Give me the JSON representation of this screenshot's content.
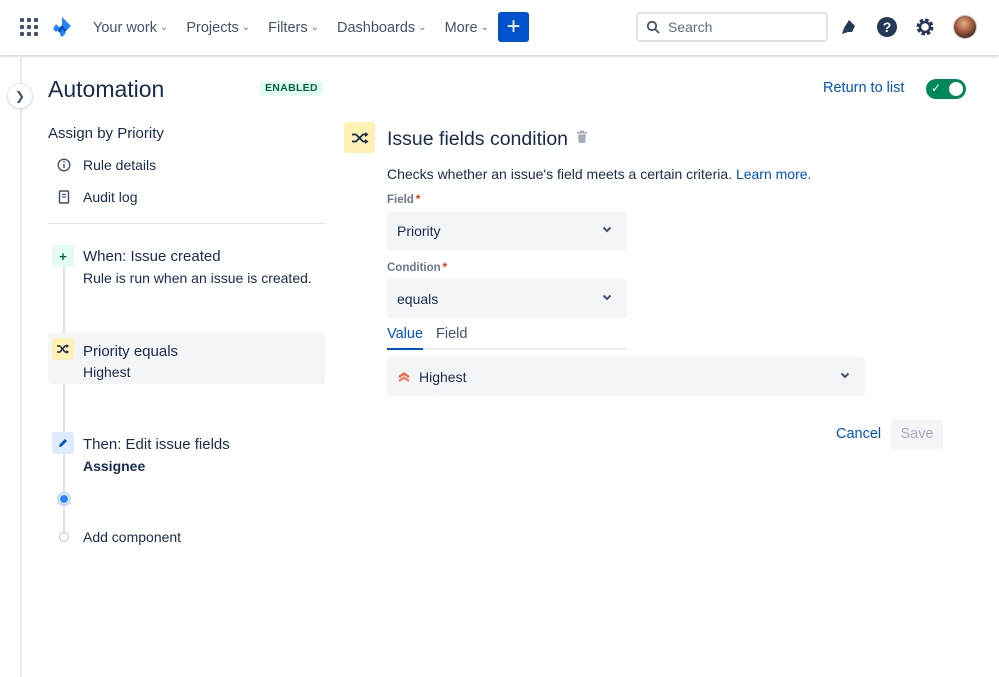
{
  "nav": {
    "items": [
      {
        "label": "Your work"
      },
      {
        "label": "Projects"
      },
      {
        "label": "Filters"
      },
      {
        "label": "Dashboards"
      },
      {
        "label": "More"
      }
    ],
    "create_label": "+",
    "search_placeholder": "Search",
    "icons": [
      "apps-grid-icon",
      "jira-logo",
      "notifications-icon",
      "help-icon",
      "settings-icon",
      "avatar"
    ]
  },
  "header": {
    "title": "Automation",
    "status_badge": "ENABLED",
    "return_link": "Return to list",
    "toggle_on": true
  },
  "sidebar": {
    "rule_name": "Assign by Priority",
    "menu": [
      {
        "label": "Rule details",
        "icon": "info-icon"
      },
      {
        "label": "Audit log",
        "icon": "document-icon"
      }
    ],
    "steps": [
      {
        "title": "When: Issue created",
        "subtitle": "Rule is run when an issue is created.",
        "icon": "plus-icon"
      },
      {
        "title": "Priority equals",
        "subtitle": "Highest",
        "icon": "shuffle-icon"
      },
      {
        "title": "Then: Edit issue fields",
        "subtitle": "Assignee",
        "icon": "pencil-icon"
      }
    ],
    "add_component": "Add component"
  },
  "panel": {
    "title": "Issue fields condition",
    "description": "Checks whether an issue's field meets a certain criteria.",
    "learn_more": "Learn more.",
    "field_label": "Field",
    "field_value": "Priority",
    "condition_label": "Condition",
    "condition_value": "equals",
    "tabs": [
      {
        "label": "Value",
        "active": true
      },
      {
        "label": "Field",
        "active": false
      }
    ],
    "value_selected": "Highest",
    "cancel_label": "Cancel",
    "save_label": "Save"
  },
  "colors": {
    "primary": "#0052cc",
    "text": "#172b4d",
    "enabled_badge_bg": "#e3fcef",
    "enabled_badge_text": "#006644",
    "toggle_on": "#00875a",
    "condition_icon_bg": "#fff0b3",
    "priority_highest": "#ff5630"
  }
}
